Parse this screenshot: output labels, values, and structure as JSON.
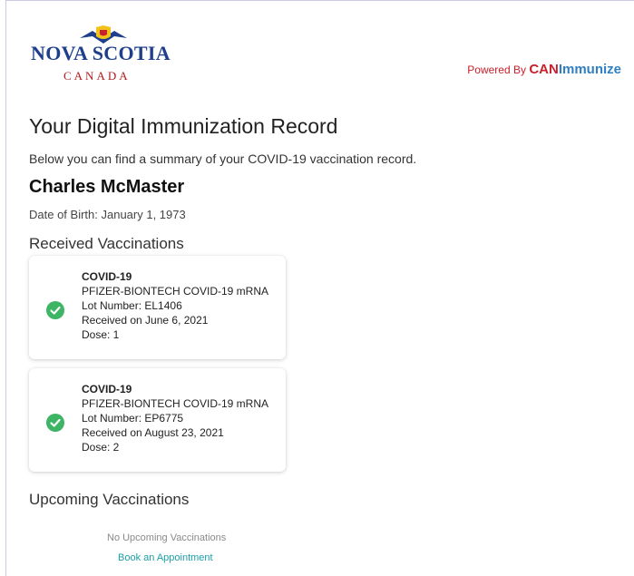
{
  "header": {
    "logo": {
      "line1": "NOVA SCOTIA",
      "line2": "CANADA"
    },
    "powered_by": {
      "prefix": "Powered By ",
      "brand_can": "CAN",
      "brand_immunize": "Immunize"
    }
  },
  "record": {
    "title": "Your Digital Immunization Record",
    "intro": "Below you can find a summary of your COVID-19 vaccination record.",
    "patient_name": "Charles McMaster",
    "dob": "Date of Birth: January 1, 1973"
  },
  "received": {
    "title": "Received Vaccinations",
    "items": [
      {
        "name": "COVID-19",
        "product": "PFIZER-BIONTECH COVID-19 mRNA",
        "lot": "Lot Number: EL1406",
        "date": "Received on June 6, 2021",
        "dose": "Dose: 1"
      },
      {
        "name": "COVID-19",
        "product": "PFIZER-BIONTECH COVID-19 mRNA",
        "lot": "Lot Number: EP6775",
        "date": "Received on August 23, 2021",
        "dose": "Dose: 2"
      }
    ]
  },
  "upcoming": {
    "title": "Upcoming Vaccinations",
    "empty_text": "No Upcoming Vaccinations",
    "book_link": "Book an Appointment"
  },
  "colors": {
    "brand_blue": "#1f3f8c",
    "brand_red": "#c8202c",
    "immunize_blue": "#2f7fc1",
    "check_green": "#3db565",
    "link_teal": "#1a9fa8"
  },
  "icons": {
    "logo_flag": "nova-scotia-flag-icon",
    "vaccination_status": "check-circle-icon"
  }
}
